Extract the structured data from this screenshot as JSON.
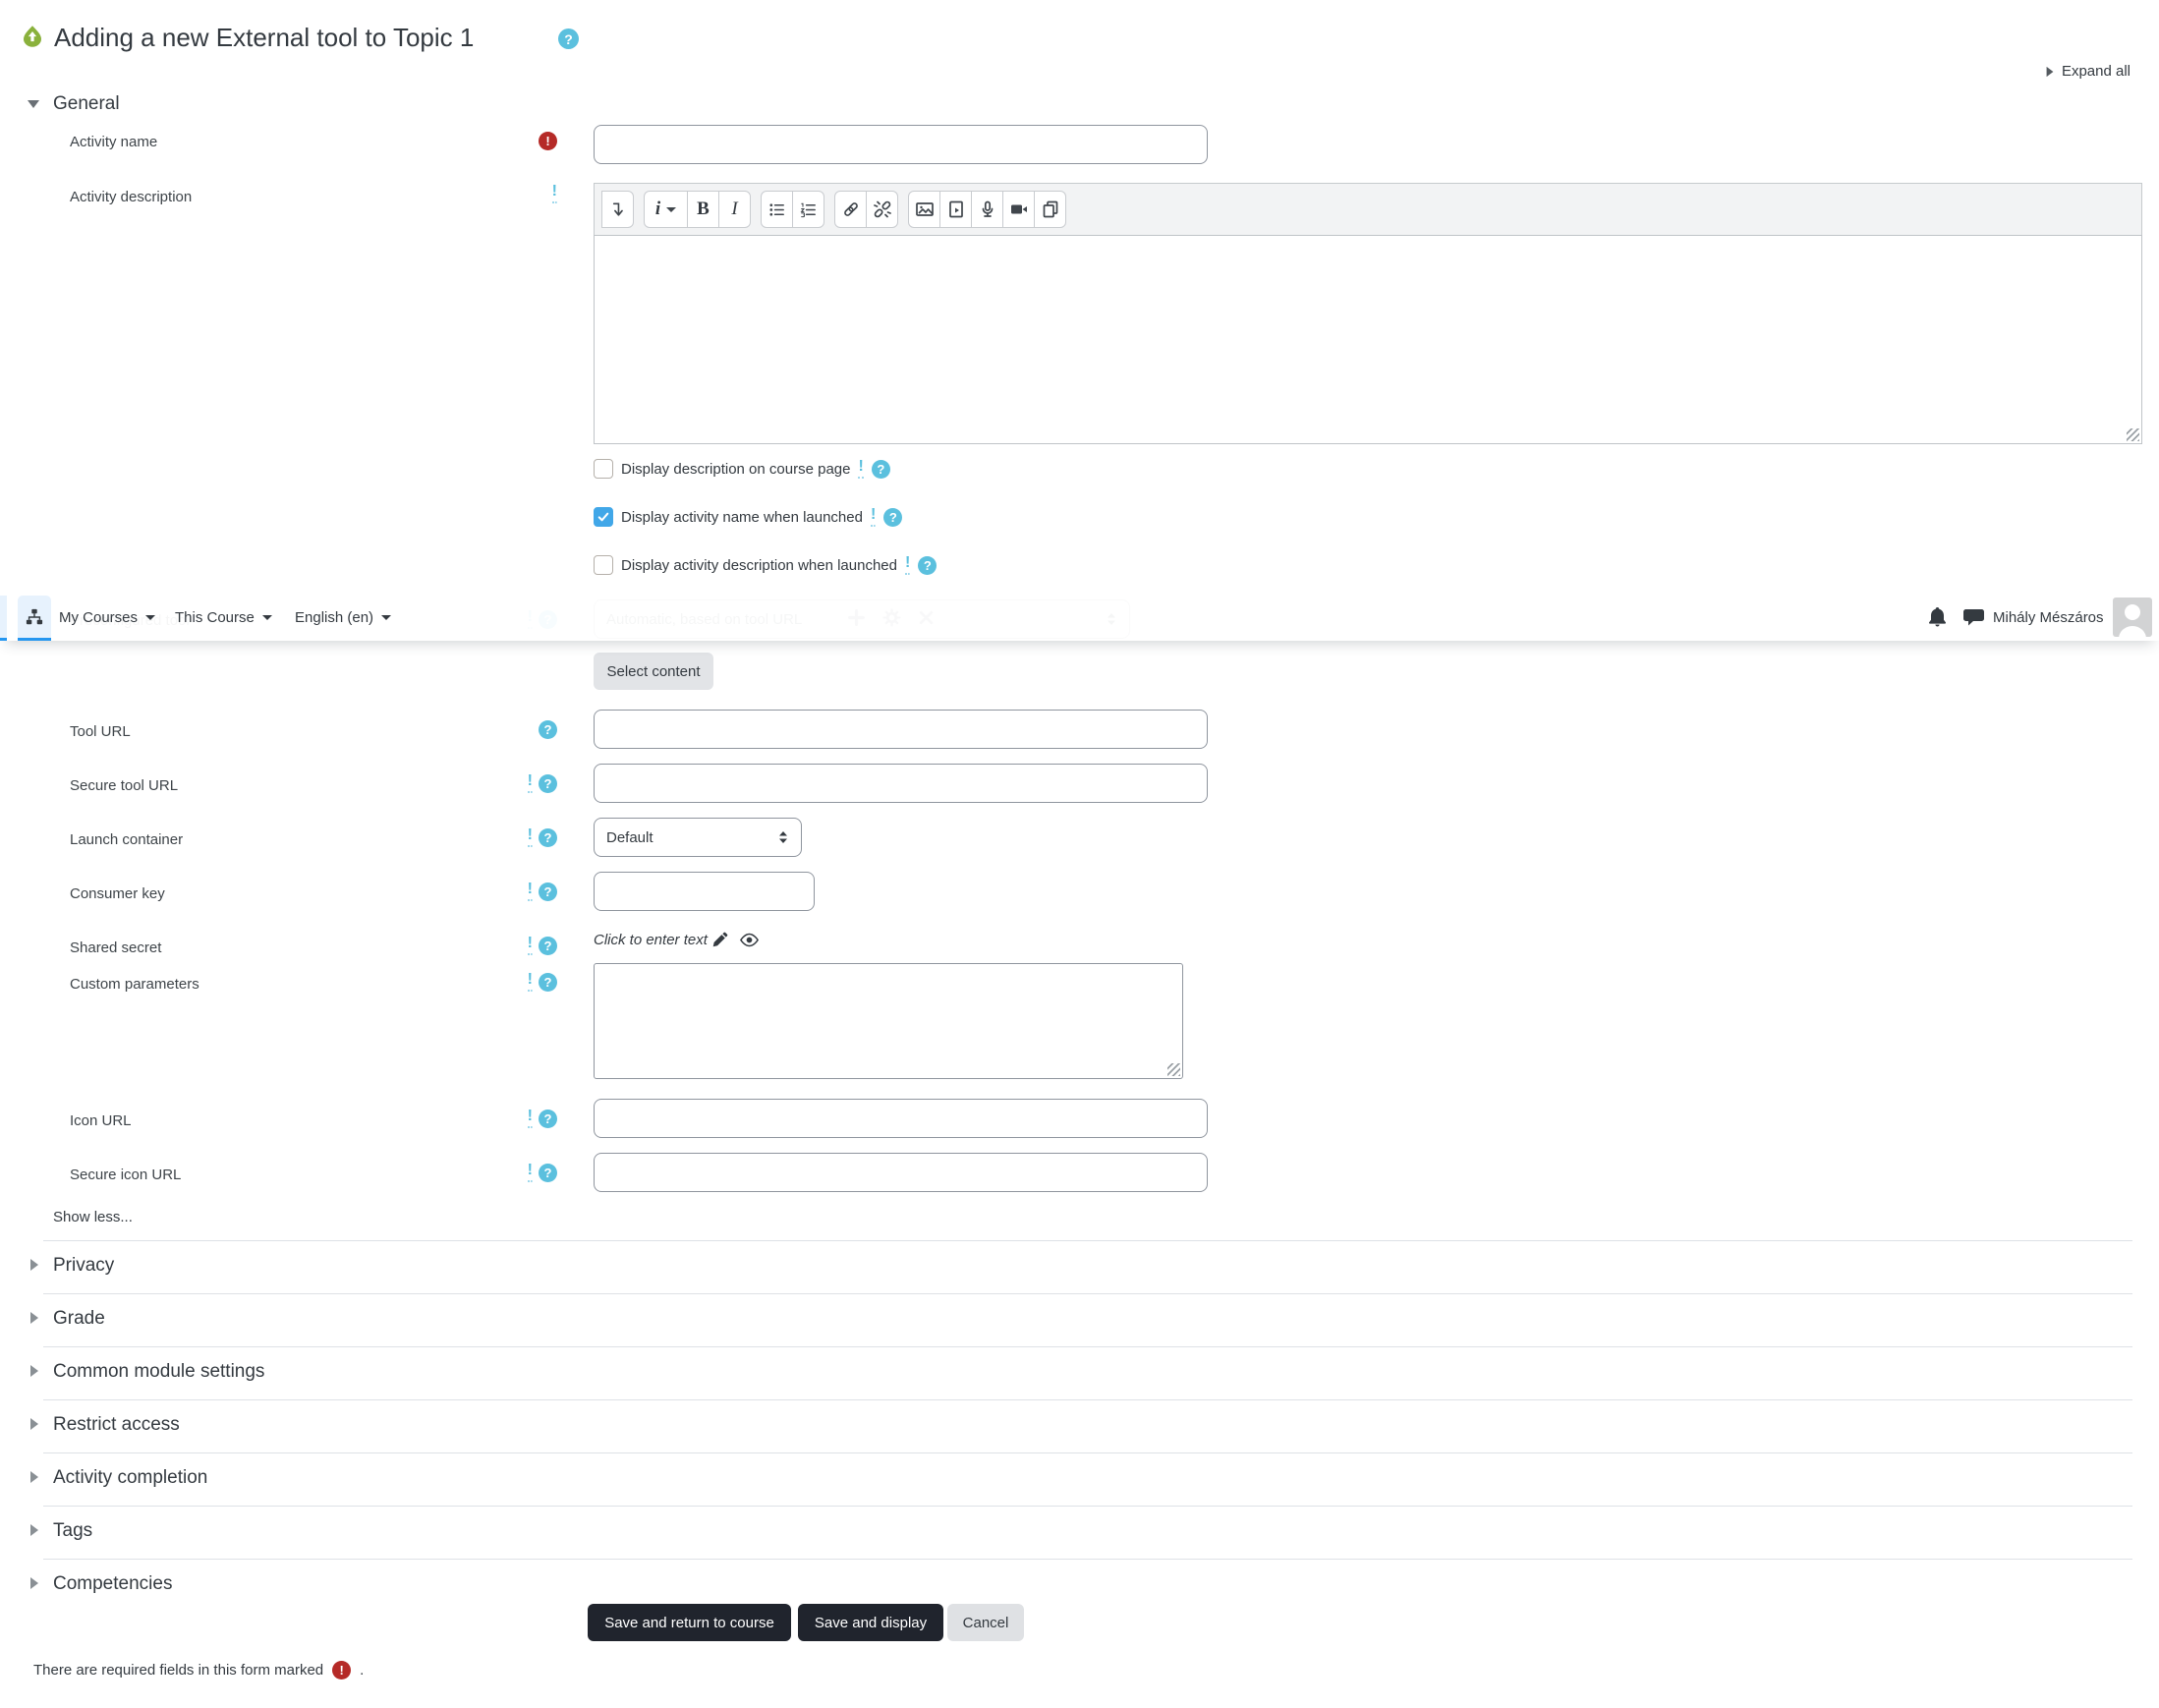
{
  "header": {
    "title": "Adding a new External tool to Topic 1",
    "expand_all": "Expand all"
  },
  "nav": {
    "menus": [
      {
        "label": "My Courses"
      },
      {
        "label": "This Course"
      },
      {
        "label": "English (en)"
      }
    ],
    "user_name": "Mihály Mészáros",
    "icons": [
      "sitemap-icon",
      "bell-icon",
      "chat-icon",
      "avatar"
    ]
  },
  "general": {
    "heading": "General",
    "select_content": "Select content",
    "show_less": "Show less...",
    "checkboxes": [
      {
        "label": "Display description on course page",
        "checked": false
      },
      {
        "label": "Display activity name when launched",
        "checked": true
      },
      {
        "label": "Display activity description when launched",
        "checked": false
      }
    ]
  },
  "fields": {
    "activity_name": {
      "label": "Activity name",
      "value": ""
    },
    "activity_description": {
      "label": "Activity description",
      "value": ""
    },
    "preconfigured_tool": {
      "label": "Preconfigured tool",
      "selected": "Automatic, based on tool URL"
    },
    "tool_url": {
      "label": "Tool URL",
      "value": ""
    },
    "secure_tool_url": {
      "label": "Secure tool URL",
      "value": ""
    },
    "launch_container": {
      "label": "Launch container",
      "selected": "Default"
    },
    "consumer_key": {
      "label": "Consumer key",
      "value": ""
    },
    "shared_secret": {
      "label": "Shared secret",
      "value": "Click to enter text"
    },
    "custom_parameters": {
      "label": "Custom parameters",
      "value": ""
    },
    "icon_url": {
      "label": "Icon URL",
      "value": ""
    },
    "secure_icon_url": {
      "label": "Secure icon URL",
      "value": ""
    }
  },
  "editor": {
    "toolbar_buttons": [
      "collapse-toolbar",
      "paragraph-styles",
      "bold",
      "italic",
      "unordered-list",
      "ordered-list",
      "link",
      "unlink",
      "insert-image",
      "insert-media",
      "record-audio",
      "record-video",
      "manage-files"
    ]
  },
  "sections": [
    {
      "label": "Privacy"
    },
    {
      "label": "Grade"
    },
    {
      "label": "Common module settings"
    },
    {
      "label": "Restrict access"
    },
    {
      "label": "Activity completion"
    },
    {
      "label": "Tags"
    },
    {
      "label": "Competencies"
    }
  ],
  "actions": {
    "save_return": "Save and return to course",
    "save_display": "Save and display",
    "cancel": "Cancel"
  },
  "footer": {
    "required_note": "There are required fields in this form marked",
    "suffix": "."
  },
  "glyphs": {
    "help": "?",
    "required": "!",
    "bang": "!",
    "style_i": "i",
    "bold": "B",
    "italic": "I",
    "plus": "+",
    "close": "×"
  },
  "colors": {
    "nav_active_blue": "#2496f0",
    "info_cyan": "#5bc0de",
    "required_red": "#b52a27",
    "checkbox_checked": "#41a7e8",
    "dark_button": "#20242d"
  }
}
